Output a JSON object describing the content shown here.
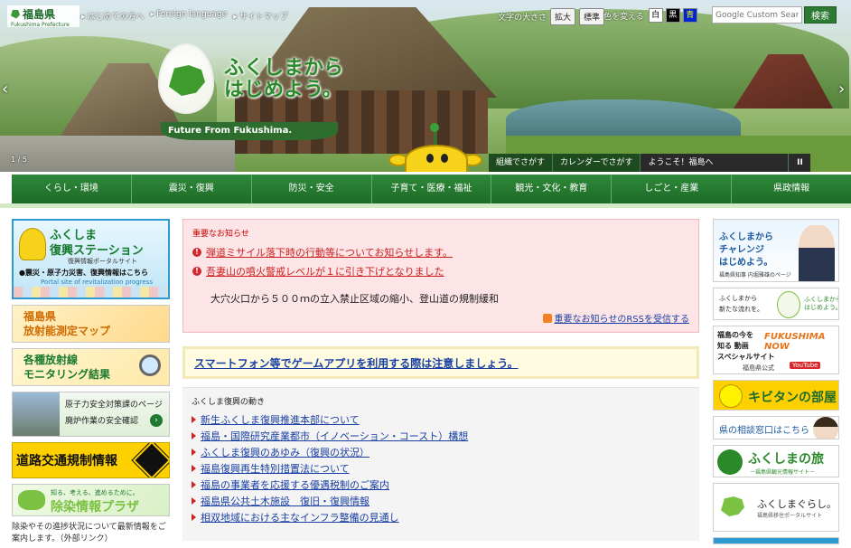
{
  "header": {
    "logo": {
      "jp": "福島県",
      "en": "Fukushima Prefecture"
    },
    "links": [
      "はじめての方へ",
      "Foreign language",
      "サイトマップ"
    ],
    "font_size": {
      "label": "文字の大きさ",
      "enlarge": "拡大",
      "standard": "標準"
    },
    "color": {
      "label": "色を変える",
      "white": "白",
      "black": "黒",
      "blue": "青"
    },
    "search": {
      "placeholder": "Google Custom Search",
      "button": "検索"
    }
  },
  "hero": {
    "slogan_line1": "ふくしまから",
    "slogan_line2": "はじめよう。",
    "tagline": "Future From Fukushima.",
    "pager": "1 / 5",
    "prev": "‹",
    "next": "›"
  },
  "quick": {
    "by_org": "組織でさがす",
    "by_calendar": "カレンダーでさがす",
    "welcome": "ようこそ！福島へ",
    "pause": "II"
  },
  "nav": [
    "くらし・環境",
    "震災・復興",
    "防災・安全",
    "子育て・医療・福祉",
    "観光・文化・教育",
    "しごと・産業",
    "県政情報"
  ],
  "left": {
    "recon": {
      "line1": "ふくしま",
      "line2": "復興ステーション",
      "line3": "復興情報ポータルサイト",
      "line4": "●震災・原子力災害、復興情報はこちら",
      "line5": "Portal site of revitalization progress"
    },
    "radiation": {
      "line1": "福島県",
      "line2": "放射能測定マップ"
    },
    "monitoring": {
      "line1": "各種放射線",
      "line2": "モニタリング結果"
    },
    "nuclear": {
      "line1": "原子力安全対策課のページ",
      "line2": "廃炉作業の安全確認",
      "go": "›"
    },
    "road": "道路交通規制情報",
    "decon": {
      "line1": "知る、考える、進めるために。",
      "line2": "除染情報プラザ"
    },
    "note": "除染やその進捗状況について最新情報をご案内します。（外部リンク）"
  },
  "alert": {
    "heading": "重要なお知らせ",
    "items": [
      "弾道ミサイル落下時の行動等についてお知らせします。",
      "吾妻山の噴火警戒レベルが１に引き下げとなりました"
    ],
    "sub": "大穴火口から５００ｍの立入禁止区域の縮小、登山道の規制緩和",
    "rss": "重要なお知らせのRSSを受信する"
  },
  "notice": "スマートフォン等でゲームアプリを利用する際は注意しましょう。",
  "recovery": {
    "heading": "ふくしま復興の動き",
    "items": [
      "新生ふくしま復興推進本部について",
      "福島・国際研究産業都市（イノベーション・コースト）構想",
      "ふくしま復興のあゆみ（復興の状況）",
      "福島復興再生特別措置法について",
      "福島の事業者を応援する優遇税制のご案内",
      "福島県公共土木施設　復旧・復興情報",
      "相双地域における主なインフラ整備の見通し"
    ]
  },
  "right": {
    "challenge": {
      "line1": "ふくしまから",
      "line2": "チャレンジ",
      "line3": "はじめよう。",
      "caption": "福島県知事 内堀雅雄のページ"
    },
    "ffs": {
      "line1": "ふくしまから",
      "line2": "新たな流れを。",
      "line3": "ふくしまから\nはじめよう。"
    },
    "now": {
      "line1": "福島の今を",
      "line2": "知る 動画",
      "line3": "スペシャルサイト",
      "logo": "FUKUSHIMA NOW",
      "caption": "福島県公式",
      "yt": "YouTube"
    },
    "kibitan": "キビタンの部屋",
    "soudan": "県の相談窓口はこちら",
    "tabi": {
      "title": "ふくしまの旅",
      "caption": "－福島県観光情報サイト－"
    },
    "kurashi": {
      "title": "ふくしまぐらし。",
      "caption": "福島県移住ポータルサイト"
    }
  }
}
